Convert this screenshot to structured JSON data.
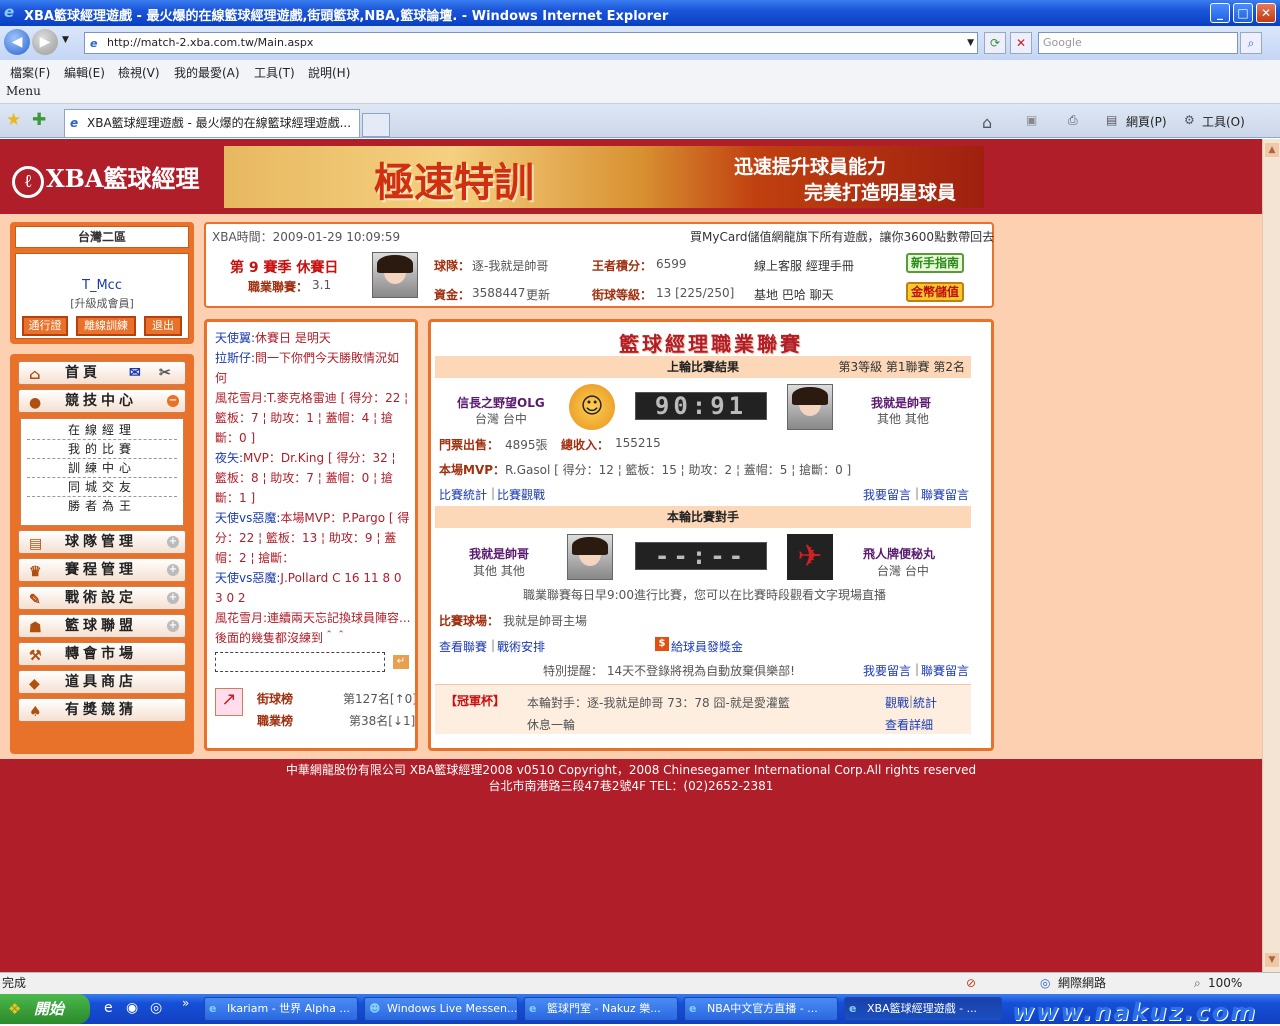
{
  "window": {
    "title": "XBA籃球經理遊戲 - 最火爆的在線籃球經理遊戲,街頭籃球,NBA,籃球論壇. - Windows Internet Explorer",
    "min": "_",
    "max": "□",
    "close": "✕"
  },
  "address": {
    "url": "http://match-2.xba.com.tw/Main.aspx",
    "search_placeholder": "Google"
  },
  "menu": {
    "items": [
      "檔案(F)",
      "編輯(E)",
      "檢視(V)",
      "我的最愛(A)",
      "工具(T)",
      "說明(H)"
    ],
    "label": "Menu"
  },
  "tabs": {
    "active": "XBA籃球經理遊戲 - 最火爆的在線籃球經理遊戲...",
    "page": "網頁(P)",
    "tools": "工具(O)"
  },
  "site": {
    "logo_text": "XBA籃球經理",
    "banner": {
      "headline": "極速特訓",
      "line1": "迅速提升球員能力",
      "line2": "完美打造明星球員"
    }
  },
  "user": {
    "area": "台灣二區",
    "name": "T_Mcc",
    "level": "[升級成會員]",
    "btn_pass": "通行證",
    "btn_offline": "離線訓練",
    "btn_exit": "退出"
  },
  "nav": {
    "home": "首頁",
    "arena": "競技中心",
    "team": "球隊管理",
    "schedule": "賽程管理",
    "tactics": "戰術設定",
    "union": "籃球聯盟",
    "transfer": "轉會市場",
    "shop": "道具商店",
    "lottery": "有獎競猜",
    "sub": [
      "在線經理",
      "我的比賽",
      "訓練中心",
      "同城交友",
      "勝者為王"
    ]
  },
  "info": {
    "time": "XBA時間：2009-01-29 10:09:59",
    "mycard": "買MyCard儲值網龍旗下所有遊戲，讓你3600點數帶回去",
    "season": "第 9 賽季 休賽日",
    "league_label": "職業聯賽：",
    "league_val": "3.1",
    "team_label": "球隊：",
    "team_val": "逐-我就是帥哥",
    "money_label": "資金：",
    "money_val": "3588447",
    "update": "更新",
    "king_label": "王者積分：",
    "king_val": "6599",
    "street_label": "街球等級：",
    "street_val": "13 [225/250]",
    "links1": "線上客服  經理手冊",
    "links2": "基地  巴哈  聊天",
    "guide_btn": "新手指南",
    "gold_btn": "金幣儲值"
  },
  "chat": {
    "messages": [
      {
        "n": "天使翼:",
        "t": "休賽日 是明天"
      },
      {
        "n": "拉斯仔:",
        "t": "問一下你們今天勝敗情況如何"
      },
      {
        "n": "",
        "t": "風花雪月:T.麥克格雷迪 [ 得分：22 ¦ 籃板：7 ¦ 助攻：1 ¦ 蓋帽：4 ¦ 搶斷：0 ]"
      },
      {
        "n": "夜矢:",
        "t": "MVP：Dr.King [ 得分：32 ¦ 籃板：8 ¦ 助攻：7 ¦ 蓋帽：0 ¦ 搶斷：1 ]"
      },
      {
        "n": "天使vs惡魔:",
        "t": "本場MVP：P.Pargo [ 得分：22 ¦ 籃板：13 ¦ 助攻：9 ¦ 蓋帽：2 ¦ 搶斷："
      },
      {
        "n": "天使vs惡魔:",
        "t": "J.Pollard C 16 11 8 0 3 0 2"
      },
      {
        "n": "",
        "t": "風花雪月:連續兩天忘記換球員陣容..."
      },
      {
        "n": "",
        "t": "後面的幾隻都沒練到＾＾"
      }
    ],
    "street_rank": "街球榜",
    "street_rank_val": "第127名[↑0]",
    "pro_rank": "職業榜",
    "pro_rank_val": "第38名[↓1]",
    "send": "↵"
  },
  "league": {
    "title": "籃球經理職業聯賽",
    "last_result": "上輪比賽結果",
    "tier": "第3等級  第1聯賽  第2名",
    "home_team": "信長之野望OLG",
    "home_loc": "台灣 台中",
    "score": "90:91",
    "away_team": "我就是帥哥",
    "away_loc": "其他 其他",
    "tickets_label": "門票出售：",
    "tickets_val": "4895張",
    "income_label": "總收入：",
    "income_val": "155215",
    "mvp_label": "本場MVP：",
    "mvp_val": "R.Gasol [ 得分：12 ¦ 籃板：15 ¦ 助攻：2 ¦ 蓋帽：5 ¦ 搶斷：0 ]",
    "stats": "比賽統計",
    "watch": "比賽觀戰",
    "comment": "我要留言",
    "league_comment": "聯賽留言",
    "opp_title": "本輪比賽對手",
    "opp_home": "我就是帥哥",
    "opp_home_loc": "其他 其他",
    "opp_score": "--:--",
    "opp_away": "飛人牌便秘丸",
    "opp_away_loc": "台灣 台中",
    "notice": "職業聯賽每日早9:00進行比賽，您可以在比賽時段觀看文字現場直播",
    "venue_label": "比賽球場：",
    "venue_val": "我就是帥哥主場",
    "view_league": "查看聯賽",
    "tactics": "戰術安排",
    "bonus": "給球員發獎金",
    "warn": "特別提醒：  14天不登錄將視為自動放棄俱樂部!",
    "cup": "【冠軍杯】",
    "cup_opp": "本輪對手：逐-我就是帥哥  73：78 囧-就是愛灌籃",
    "cup_rest": "休息一輪",
    "cup_watch": "觀戰",
    "cup_stats": "統計",
    "cup_detail": "查看詳細"
  },
  "footer": {
    "line1": "中華網龍股份有限公司  XBA籃球經理2008 v0510     Copyright，2008 Chinesegamer International Corp.All rights reserved",
    "line2": "台北市南港路三段47巷2號4F TEL：(02)2652-2381"
  },
  "status": {
    "left": "完成",
    "zone": "網際網路",
    "zoom": "100%"
  },
  "taskbar": {
    "start": "開始",
    "tasks": [
      "Ikariam - 世界 Alpha ...",
      "Windows Live Messen...",
      "籃球門室 - Nakuz 樂...",
      "NBA中文官方直播 - ...",
      "XBA籃球經理遊戲 - ..."
    ],
    "watermark": "www.nakuz.com"
  }
}
